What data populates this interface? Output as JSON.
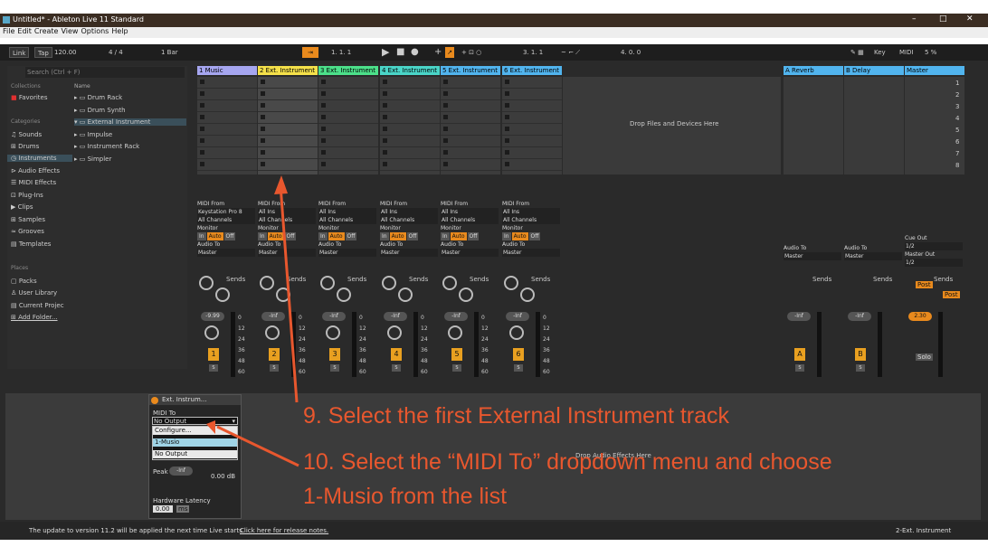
{
  "window": {
    "title": "Untitled* - Ableton Live 11 Standard",
    "min": "–",
    "max": "□",
    "close": "✕"
  },
  "menu": [
    "File",
    "Edit",
    "Create",
    "View",
    "Options",
    "Help"
  ],
  "transport": {
    "link": "Link",
    "tap": "Tap",
    "tempo": "120.00",
    "sig": "4 / 4",
    "quant": "1 Bar",
    "pos": "1.   1.   1",
    "loop_start": "3.   1.   1",
    "loop_len": "4.   0.   0",
    "key": "Key",
    "midi": "MIDI",
    "cpu": "5 %"
  },
  "browser": {
    "search": "Search (Ctrl + F)",
    "collections_label": "Collections",
    "favorites": "Favorites",
    "categories_label": "Categories",
    "categories": [
      "Sounds",
      "Drums",
      "Instruments",
      "Audio Effects",
      "MIDI Effects",
      "Plug-Ins",
      "Clips",
      "Samples",
      "Grooves",
      "Templates"
    ],
    "places_label": "Places",
    "places": [
      "Packs",
      "User Library",
      "Current Projec",
      "Add Folder..."
    ],
    "name_header": "Name",
    "items": [
      "Drum Rack",
      "Drum Synth",
      "External Instrument",
      "Impulse",
      "Instrument Rack",
      "Simpler"
    ]
  },
  "tracks": [
    {
      "name": "1 Music",
      "color": "#a6a6f0",
      "from": "Keystation Pro 8",
      "num": "1",
      "vol": "-9.99"
    },
    {
      "name": "2 Ext. Instrument",
      "color": "#f5e14a",
      "from": "All Ins",
      "num": "2",
      "vol": "-Inf"
    },
    {
      "name": "3 Ext. Instrument",
      "color": "#4ce08a",
      "from": "All Ins",
      "num": "3",
      "vol": "-Inf"
    },
    {
      "name": "4 Ext. Instrument",
      "color": "#4ad5c8",
      "from": "All Ins",
      "num": "4",
      "vol": "-Inf"
    },
    {
      "name": "5 Ext. Instrument",
      "color": "#51b4ee",
      "from": "All Ins",
      "num": "5",
      "vol": "-Inf"
    },
    {
      "name": "6 Ext. Instrument",
      "color": "#51b4ee",
      "from": "All Ins",
      "num": "6",
      "vol": "-Inf"
    }
  ],
  "returns": [
    {
      "name": "A Reverb",
      "color": "#51b4ee",
      "btn": "A",
      "vol": "-Inf"
    },
    {
      "name": "B Delay",
      "color": "#51b4ee",
      "btn": "B",
      "vol": "-Inf"
    },
    {
      "name": "Master",
      "color": "#51b4ee",
      "vol": "2.30"
    }
  ],
  "io": {
    "midi_from": "MIDI From",
    "channels": "All Channels",
    "monitor": "Monitor",
    "in": "In",
    "auto": "Auto",
    "off": "Off",
    "audio_to": "Audio To",
    "master": "Master",
    "cue_out": "Cue Out",
    "cue_val": "1/2",
    "master_out": "Master Out",
    "master_val": "1/2",
    "sends": "Sends",
    "post": "Post",
    "solo": "Solo",
    "s": "S"
  },
  "scales": [
    "0",
    "12",
    "24",
    "36",
    "48",
    "60"
  ],
  "scene_nums": [
    "1",
    "2",
    "3",
    "4",
    "5",
    "6",
    "7",
    "8"
  ],
  "drop_files": "Drop Files and Devices Here",
  "device": {
    "title": "Ext. Instrum...",
    "midi_to": "MIDI To",
    "selected": "No Output",
    "options": [
      "Configure...",
      "1-Musio",
      "No Output"
    ],
    "peak": "Peak",
    "peak_val": "-Inf",
    "gain": "0.00 dB",
    "latency": "Hardware Latency",
    "lat_val": "0.00",
    "lat_unit": "ms",
    "drop_audio": "Drop Audio Effects Here"
  },
  "annotations": {
    "step9": "9. Select the first External Instrument track",
    "step10a": "10. Select the “MIDI To” dropdown menu and choose",
    "step10b": "1-Musio from the list"
  },
  "status": {
    "msg": "The update to version 11.2 will be applied the next time Live starts.",
    "link": "Click here for release notes.",
    "track": "2-Ext. Instrument"
  }
}
